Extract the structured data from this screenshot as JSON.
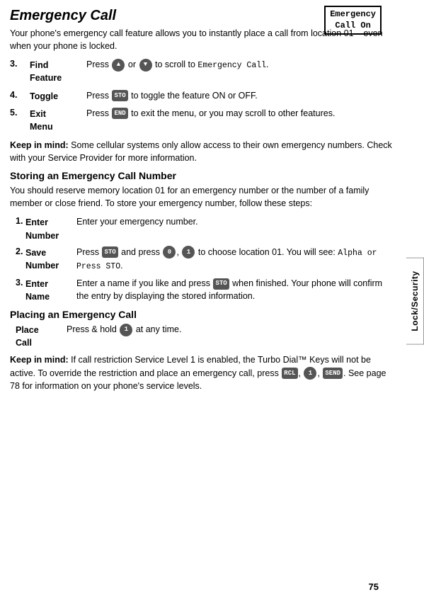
{
  "page": {
    "title": "Emergency Call",
    "top_box": {
      "line1": "Emergency",
      "line2": "Call On"
    },
    "intro_text": "Your phone's emergency call feature allows you to instantly place a call from location 01 – even when your phone is locked.",
    "main_steps": [
      {
        "number": "3.",
        "term": "Find Feature",
        "desc_prefix": "Press ",
        "desc_suffix": " or ",
        "desc_end": " to scroll to ",
        "code": "Emergency Call",
        "btn1": "▲",
        "btn2": "▼"
      },
      {
        "number": "4.",
        "term": "Toggle",
        "desc_prefix": "Press ",
        "btn1": "STO",
        "desc_suffix": " to toggle the feature ON or OFF."
      },
      {
        "number": "5.",
        "term": "Exit Menu",
        "desc_prefix": "Press ",
        "btn1": "END",
        "desc_suffix": " to exit the menu, or you may scroll to other features."
      }
    ],
    "keep_in_mind_1": "Keep in mind: Some cellular systems only allow access to their own emergency numbers. Check with your Service Provider for more information.",
    "section1_heading": "Storing an Emergency Call Number",
    "section1_text": "You should reserve memory location 01 for an emergency number or the number of a family member or close friend. To store your emergency number, follow these steps:",
    "storing_steps": [
      {
        "number": "1.",
        "term": "Enter Number",
        "desc": "Enter your emergency number."
      },
      {
        "number": "2.",
        "term": "Save Number",
        "desc_prefix": "Press ",
        "btn1": "STO",
        "desc_mid": " and press ",
        "btn2": "0",
        "desc_comma": ", ",
        "btn3": "1",
        "desc_suffix": " to choose location 01. You will see: ",
        "code": "Alpha or Press STO"
      },
      {
        "number": "3.",
        "term": "Enter Name",
        "desc_prefix": "Enter a name if you like and press ",
        "btn1": "STO",
        "desc_suffix": " when finished. Your phone will confirm the entry by displaying the stored information."
      }
    ],
    "section2_heading": "Placing an Emergency Call",
    "placing_steps": [
      {
        "term": "Place Call",
        "desc_prefix": "Press & hold ",
        "btn1": "1",
        "desc_suffix": " at any time."
      }
    ],
    "keep_in_mind_2_prefix": "Keep in mind:",
    "keep_in_mind_2": " If call restriction Service Level 1 is enabled, the Turbo Dial™ Keys will not be active. To override the restriction and place an emergency call, press ",
    "keep_in_mind_2_code1": "RCL",
    "keep_in_mind_2_sep1": ", ",
    "keep_in_mind_2_code2": "1",
    "keep_in_mind_2_sep2": ", ",
    "keep_in_mind_2_code3": "SEND",
    "keep_in_mind_2_end": ". See page 78 for information on your phone's service levels.",
    "page_number": "75",
    "side_tab_label": "Lock/Security"
  }
}
